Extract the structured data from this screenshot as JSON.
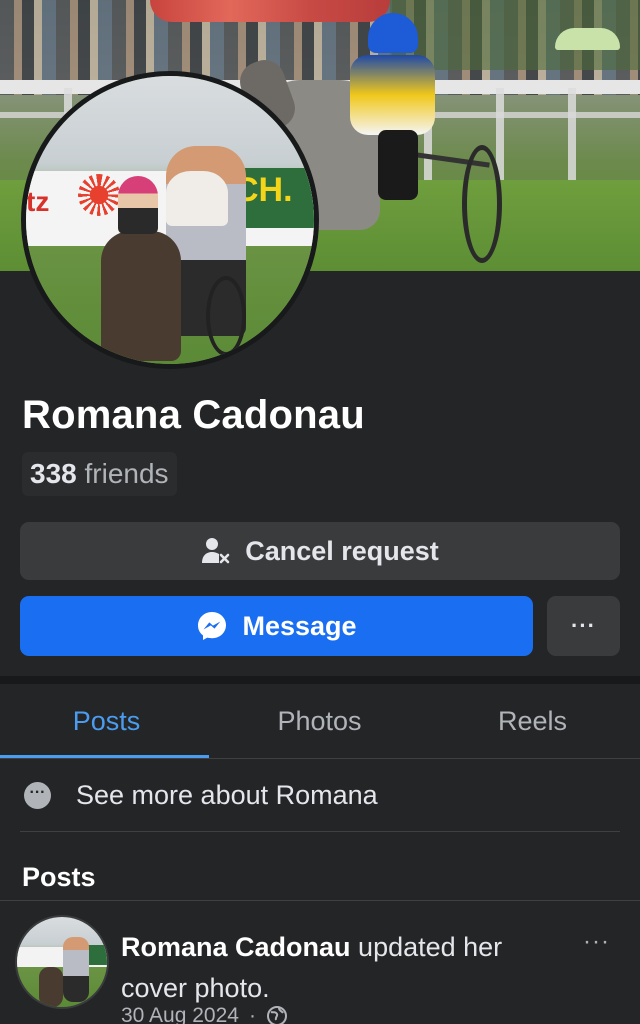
{
  "profile": {
    "name": "Romana Cadonau",
    "friends_count": "338",
    "friends_label": "friends"
  },
  "actions": {
    "cancel_request": "Cancel request",
    "message": "Message",
    "more": "···"
  },
  "tabs": [
    {
      "label": "Posts",
      "active": true
    },
    {
      "label": "Photos",
      "active": false
    },
    {
      "label": "Reels",
      "active": false
    }
  ],
  "about": {
    "see_more": "See more about Romana"
  },
  "posts_section": {
    "heading": "Posts",
    "items": [
      {
        "author": "Romana Cadonau",
        "action": "updated her cover photo.",
        "date": "30 Aug 2024",
        "separator": "·",
        "privacy_icon": "globe-icon",
        "more": "···"
      }
    ]
  },
  "colors": {
    "background": "#242526",
    "primary_button": "#1a6ef2",
    "secondary_button": "#3a3b3c",
    "active_tab": "#4b9cf0",
    "muted_text": "#b0b3b8"
  }
}
